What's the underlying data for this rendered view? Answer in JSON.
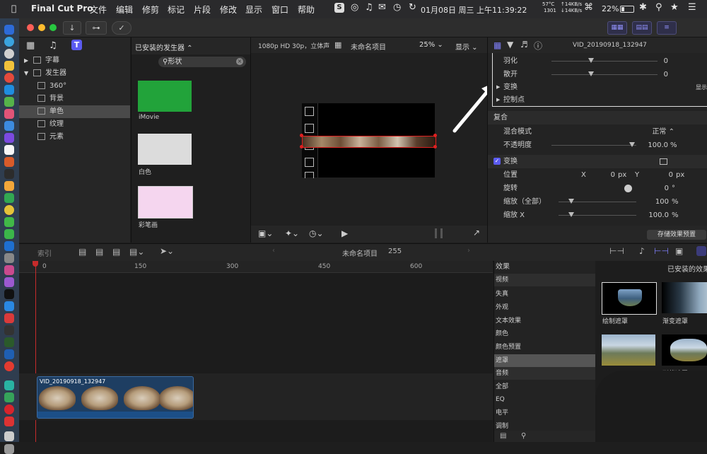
{
  "menubar": {
    "app": "Final Cut Pro",
    "items": [
      "文件",
      "编辑",
      "修剪",
      "标记",
      "片段",
      "修改",
      "显示",
      "窗口",
      "帮助"
    ],
    "stats": {
      "temp": "57°C",
      "fan": "1301",
      "up": "↑14KB/s",
      "down": "↓14KB/s"
    },
    "battery": "22%",
    "datetime": "01月08日 周三 上午11:39:22"
  },
  "toolbar": {
    "import_icon": "↓",
    "key_icon": "⊶",
    "check_icon": "✓"
  },
  "library": {
    "items": [
      {
        "label": "字幕",
        "kind": "category"
      },
      {
        "label": "发生器",
        "kind": "category"
      },
      {
        "label": "360°",
        "kind": "sub"
      },
      {
        "label": "背景",
        "kind": "sub"
      },
      {
        "label": "单色",
        "kind": "sub"
      },
      {
        "label": "纹理",
        "kind": "sub"
      },
      {
        "label": "元素",
        "kind": "sub"
      }
    ]
  },
  "generators": {
    "title": "已安装的发生器 ⌃",
    "search_value": "形状",
    "items": [
      {
        "label": "iMovie",
        "color": "#22a33a"
      },
      {
        "label": "白色",
        "color": "#dcdcdc"
      },
      {
        "label": "彩笔画",
        "color": "#f5d6ef"
      }
    ]
  },
  "viewer": {
    "format": "1080p HD 30p，立体声",
    "project": "未命名项目",
    "zoom": "25%",
    "display": "显示"
  },
  "inspector": {
    "clip_name": "VID_20190918_132947",
    "rows": {
      "feather_label": "羽化",
      "feather_value": "0",
      "spread_label": "散开",
      "spread_value": "0",
      "transform_label": "变换",
      "transform_show": "显示",
      "controls_label": "控制点",
      "composite_label": "复合",
      "blend_label": "混合模式",
      "blend_value": "正常 ⌃",
      "opacity_label": "不透明度",
      "opacity_value": "100.0",
      "opacity_unit": "%",
      "transform2_label": "变换",
      "position_label": "位置",
      "position_x_label": "X",
      "position_x": "0",
      "position_x_unit": "px",
      "position_y_label": "Y",
      "position_y": "0",
      "position_y_unit": "px",
      "rotation_label": "旋转",
      "rotation_value": "0",
      "rotation_unit": "°",
      "scale_label": "缩放（全部）",
      "scale_value": "100",
      "scale_unit": "%",
      "scalex_label": "缩放 X",
      "scalex_value": "100.0",
      "scalex_unit": "%"
    },
    "save_preset": "存储效果预置"
  },
  "timeline": {
    "index_label": "索引",
    "project_name": "未命名项目",
    "duration": "255",
    "ruler": [
      "0",
      "150",
      "300",
      "450",
      "600"
    ],
    "clip_name": "VID_20190918_132947"
  },
  "effects": {
    "header": "效果",
    "pane_title": "已安装的效果",
    "categories": [
      {
        "label": "视频",
        "kind": "cat"
      },
      {
        "label": "失真",
        "kind": "item"
      },
      {
        "label": "外观",
        "kind": "item"
      },
      {
        "label": "文本效果",
        "kind": "item"
      },
      {
        "label": "颜色",
        "kind": "item"
      },
      {
        "label": "颜色预置",
        "kind": "item"
      },
      {
        "label": "遮罩",
        "kind": "sel"
      },
      {
        "label": "音频",
        "kind": "cat"
      },
      {
        "label": "全部",
        "kind": "item"
      },
      {
        "label": "EQ",
        "kind": "item"
      },
      {
        "label": "电平",
        "kind": "item"
      },
      {
        "label": "调制",
        "kind": "item"
      }
    ],
    "thumbs": [
      {
        "label": "绘制遮罩"
      },
      {
        "label": "渐变遮罩"
      },
      {
        "label": ""
      },
      {
        "label": "形状遮罩"
      }
    ]
  },
  "colors": {
    "accent": "#5b5bf0",
    "selection_red": "#e02020"
  }
}
